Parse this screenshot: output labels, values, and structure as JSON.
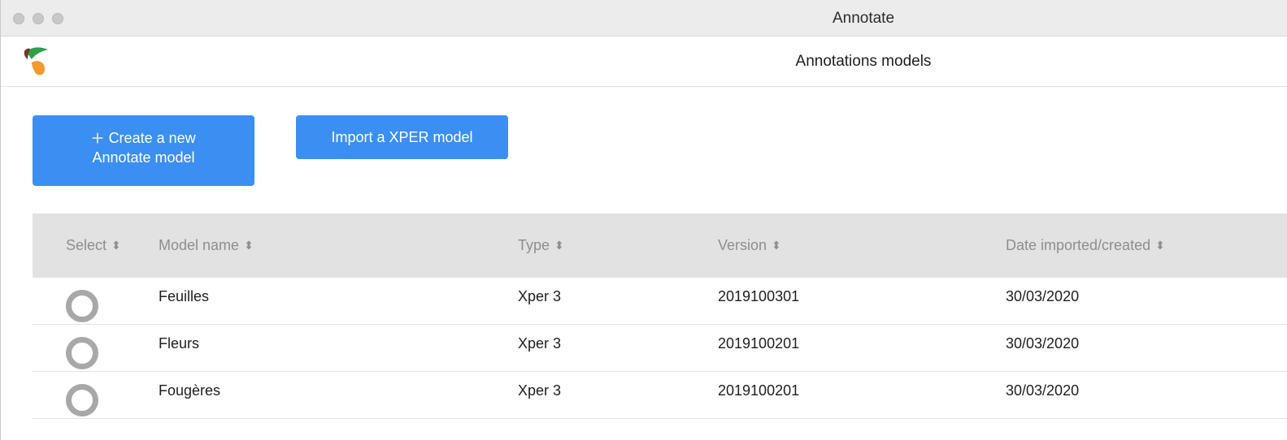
{
  "window": {
    "title": "Annotate"
  },
  "header": {
    "title": "Annotations models",
    "logo": "annotate-logo"
  },
  "actions": {
    "create_line1": "Create a new",
    "create_line2": "Annotate model",
    "create_icon": "plus-icon",
    "import_label": "Import a XPER model"
  },
  "table": {
    "columns": [
      "Select",
      "Model name",
      "Type",
      "Version",
      "Date imported/created"
    ],
    "sort_icon": "sort-icon",
    "rows": [
      {
        "name": "Feuilles",
        "type": "Xper 3",
        "version": "2019100301",
        "date": "30/03/2020",
        "selected": false
      },
      {
        "name": "Fleurs",
        "type": "Xper 3",
        "version": "2019100201",
        "date": "30/03/2020",
        "selected": false
      },
      {
        "name": "Fougères",
        "type": "Xper 3",
        "version": "2019100201",
        "date": "30/03/2020",
        "selected": false
      }
    ]
  },
  "colors": {
    "accent": "#3b8ff2",
    "header_bg": "#e2e2e2",
    "radio": "#a8a8a8",
    "logo_green": "#2e9e4a",
    "logo_orange": "#f29a2e",
    "logo_brown": "#6b3b2a"
  }
}
